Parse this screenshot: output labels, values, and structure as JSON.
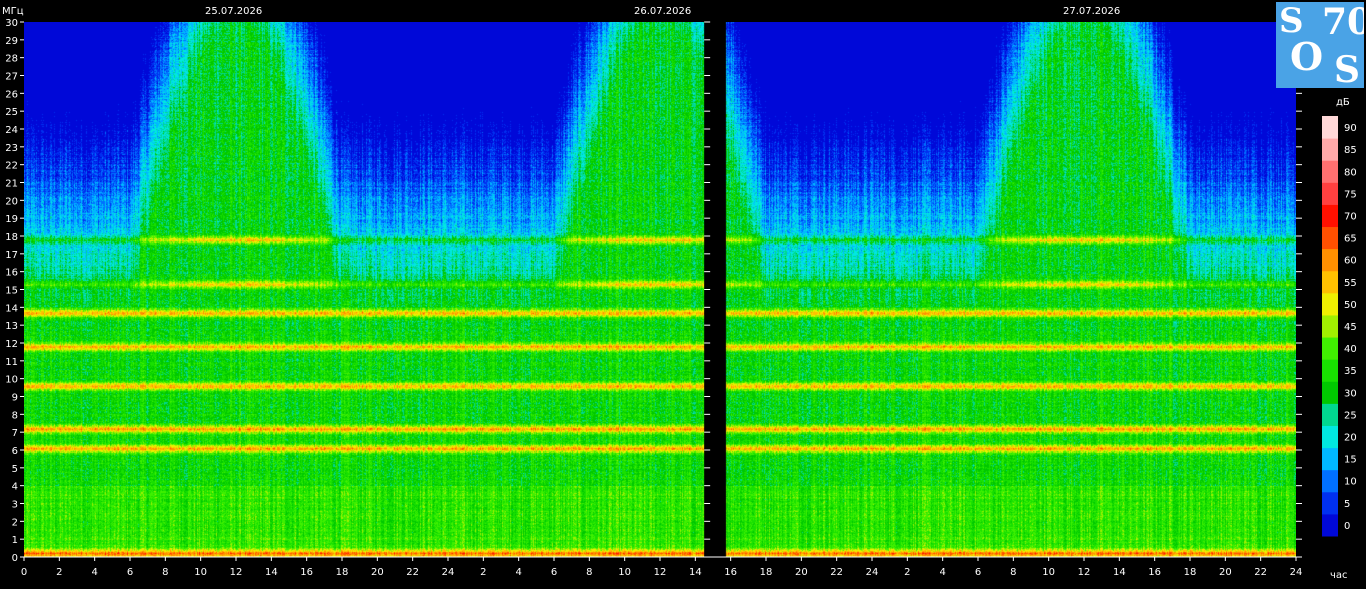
{
  "chart_data": {
    "type": "heatmap",
    "title": "",
    "ylabel": "МГц",
    "xlabel": "час",
    "dates": [
      "25.07.2026",
      "26.07.2026",
      "27.07.2026"
    ],
    "y_ticks": [
      0,
      1,
      2,
      3,
      4,
      5,
      6,
      7,
      8,
      9,
      10,
      11,
      12,
      13,
      14,
      15,
      16,
      17,
      18,
      19,
      20,
      21,
      22,
      23,
      24,
      25,
      26,
      27,
      28,
      29,
      30
    ],
    "ylim": [
      0,
      30
    ],
    "x_tick_labels": [
      "0",
      "2",
      "4",
      "6",
      "8",
      "10",
      "12",
      "14",
      "16",
      "18",
      "20",
      "22",
      "24",
      "2",
      "4",
      "6",
      "8",
      "10",
      "12",
      "14",
      "16",
      "18",
      "20",
      "22",
      "24",
      "2",
      "4",
      "6",
      "8",
      "10",
      "12",
      "14",
      "16",
      "18",
      "20",
      "22",
      "24"
    ],
    "gap_after_hour": 38.5,
    "gap_before_hour": 39.7,
    "intense_bands_mhz": [
      0.2,
      6.1,
      7.2,
      9.6,
      11.8,
      13.7,
      15.3,
      17.8
    ],
    "colorbar": {
      "unit": "дБ",
      "ticks": [
        0,
        5,
        10,
        15,
        20,
        25,
        30,
        35,
        40,
        45,
        50,
        55,
        60,
        65,
        70,
        75,
        80,
        85,
        90
      ],
      "colors": [
        "#0008d8",
        "#0030f0",
        "#0070ff",
        "#00b8ff",
        "#00e8e0",
        "#00d890",
        "#00c800",
        "#18e000",
        "#40f000",
        "#a0f000",
        "#f0f000",
        "#ffc000",
        "#ff9000",
        "#ff5000",
        "#ff1000",
        "#ff4040",
        "#ff7070",
        "#ffa8a8",
        "#ffd8d8",
        "#ffffff"
      ]
    }
  },
  "logo": {
    "s1": "S",
    "n70": "70",
    "o": "O",
    "s2": "S"
  }
}
